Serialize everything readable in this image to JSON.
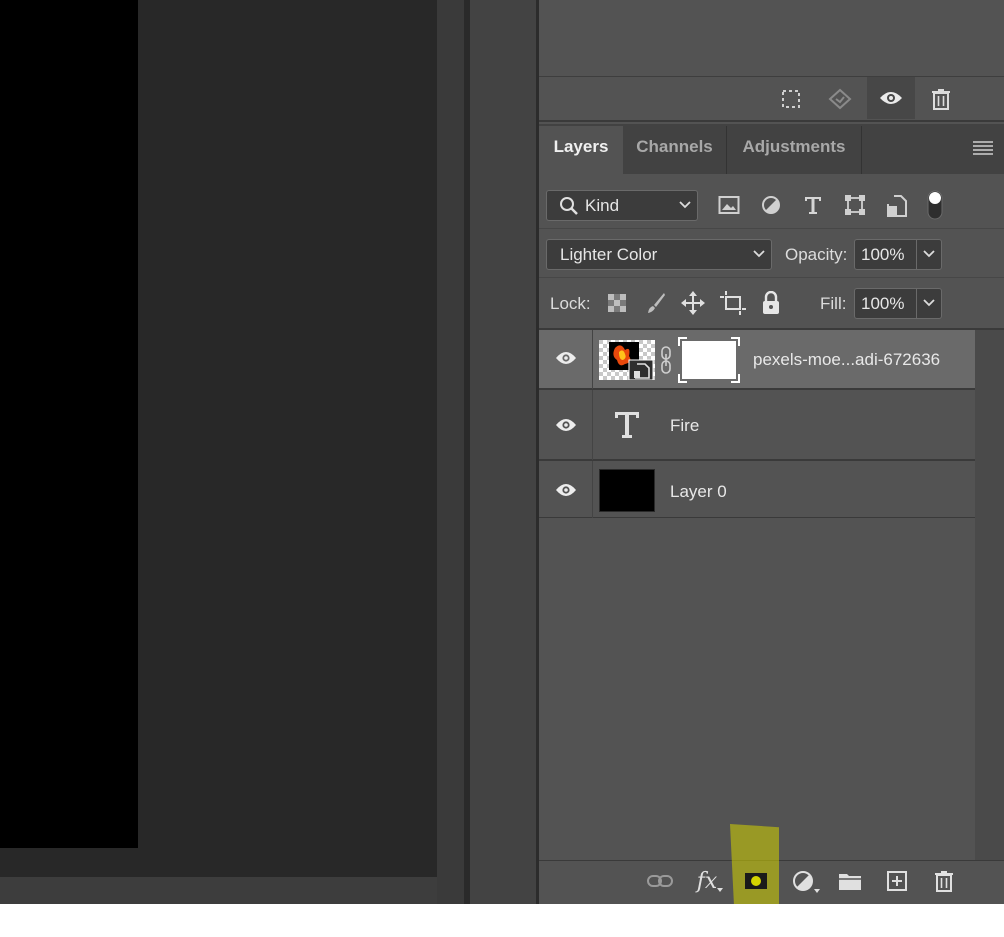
{
  "properties_toolbar": {
    "icons": [
      "selection-icon",
      "replace-layer-icon",
      "visibility-eye-icon",
      "trash-icon"
    ]
  },
  "panel_tabs": [
    {
      "label": "Layers",
      "active": true
    },
    {
      "label": "Channels",
      "active": false
    },
    {
      "label": "Adjustments",
      "active": false
    }
  ],
  "filter": {
    "kind_label": "Kind",
    "icons": [
      "image-filter-icon",
      "adjustment-filter-icon",
      "type-filter-icon",
      "shape-filter-icon",
      "smart-object-filter-icon",
      "filter-toggle-icon"
    ]
  },
  "blend": {
    "mode": "Lighter Color",
    "opacity_label": "Opacity:",
    "opacity_value": "100%"
  },
  "lock": {
    "label": "Lock:",
    "fill_label": "Fill:",
    "fill_value": "100%"
  },
  "layers": [
    {
      "name": "pexels-moe...adi-672636",
      "type": "smart-object",
      "selected": true,
      "visible": true
    },
    {
      "name": "Fire",
      "type": "text",
      "selected": false,
      "visible": true
    },
    {
      "name": "Layer 0",
      "type": "pixel",
      "selected": false,
      "visible": true
    }
  ],
  "bottom_toolbar": {
    "icons": [
      "link-layers-icon",
      "fx-icon",
      "add-mask-icon",
      "adjustment-layer-icon",
      "folder-icon",
      "new-layer-icon",
      "delete-layer-icon"
    ],
    "fx_label": "fx",
    "highlight_color": "#d4d400"
  },
  "colors": {
    "panel_bg": "#535353",
    "canvas_bg": "#282828",
    "selected_row": "#6a6a6a",
    "document": "#000000"
  }
}
